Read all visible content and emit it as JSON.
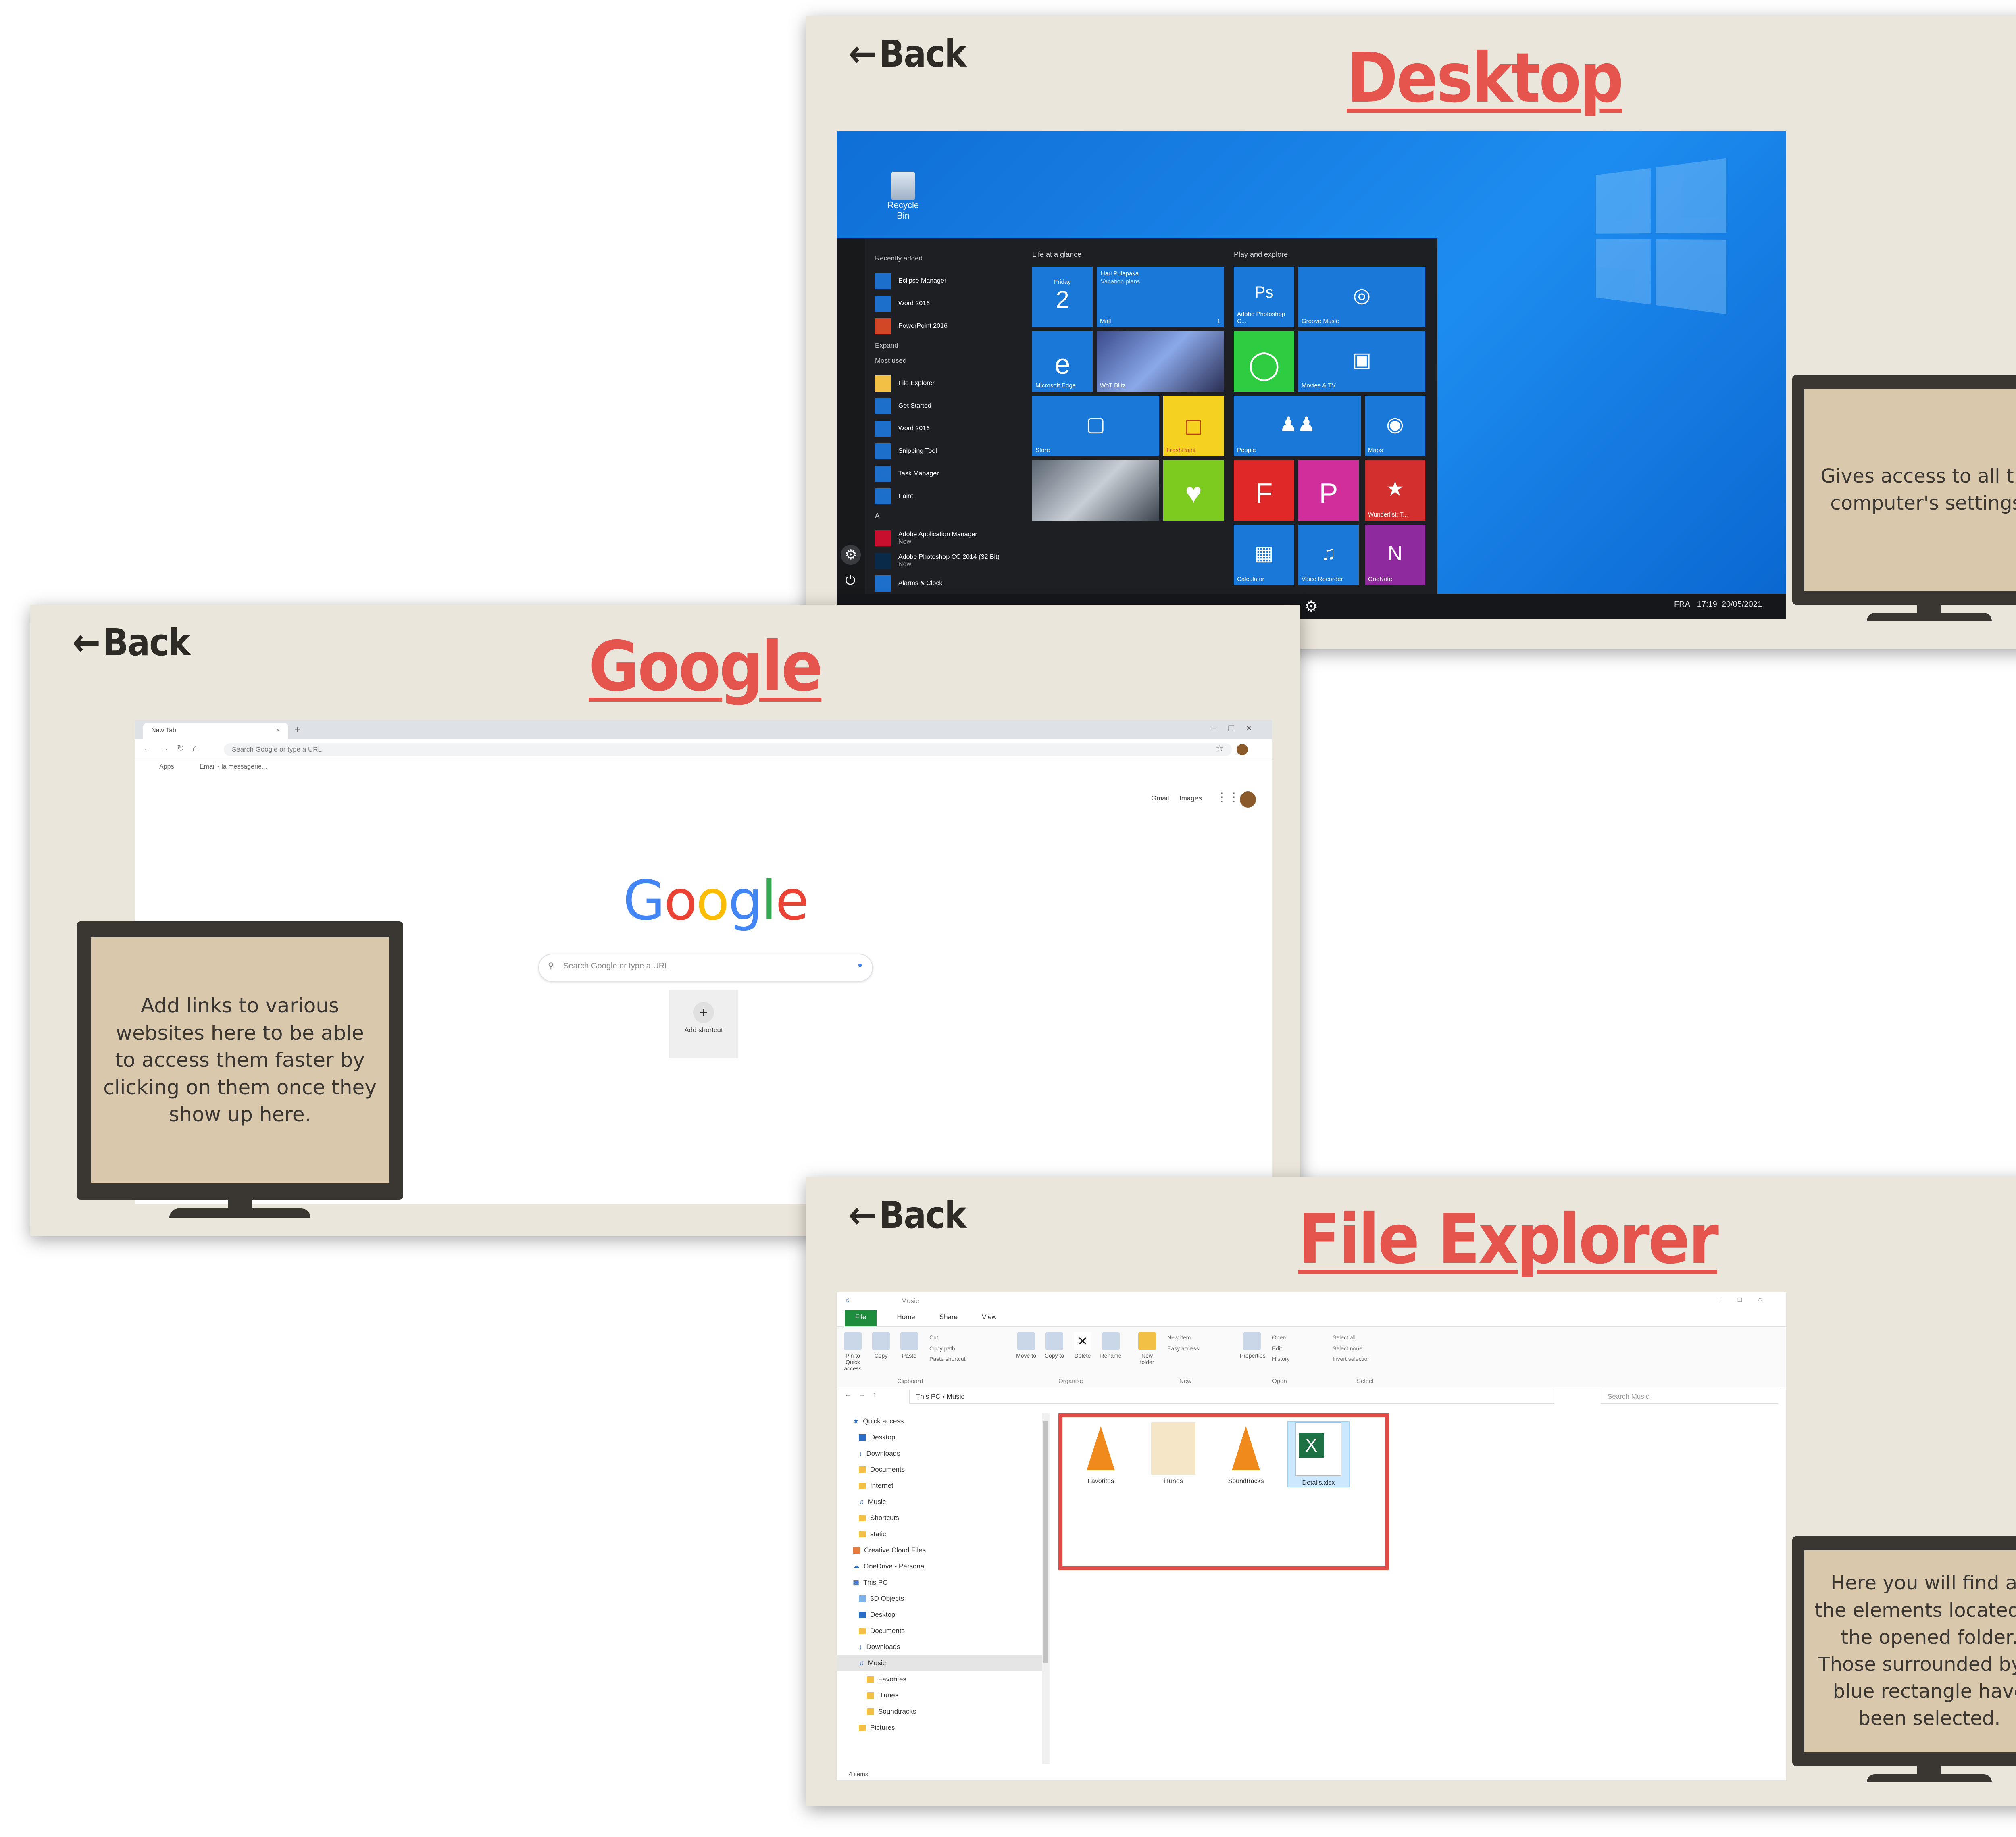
{
  "back_label": "Back",
  "desktop": {
    "title": "Desktop",
    "tooltip": "Gives access to all the computer's settings.",
    "recycle_bin": "Recycle Bin",
    "startmenu": {
      "recent_heading": "Recently added",
      "recent": [
        "Eclipse Manager",
        "Word 2016",
        "PowerPoint 2016"
      ],
      "expand": "Expand",
      "most_used_heading": "Most used",
      "most_used": [
        "File Explorer",
        "Get Started",
        "Word 2016",
        "Snipping Tool",
        "Task Manager",
        "Paint"
      ],
      "letter": "A",
      "a_apps": [
        "Adobe Application Manager",
        "Adobe Photoshop CC 2014 (32 Bit)",
        "Alarms & Clock"
      ],
      "new_label": "New",
      "group1": "Life at a glance",
      "group2": "Play and explore",
      "tiles": {
        "calendar_day": "Friday",
        "calendar_date": "2",
        "mail_from": "Hari Pulapaka",
        "mail_subject": "Vacation plans",
        "mail": "Mail",
        "mail_count": "1",
        "edge": "Microsoft Edge",
        "wot": "WoT Blitz",
        "store": "Store",
        "freshpaint": "FreshPaint",
        "photoshop": "Adobe Photoshop C...",
        "groove": "Groove Music",
        "movies": "Movies & TV",
        "people": "People",
        "maps": "Maps",
        "wunderlist": "Wunderlist: T...",
        "calculator": "Calculator",
        "voice": "Voice Recorder",
        "onenote": "OneNote"
      }
    },
    "taskbar": {
      "lang": "FRA",
      "time": "17:19",
      "date": "20/05/2021"
    }
  },
  "google": {
    "title": "Google",
    "tooltip": "Add links to various websites here to be able to access them faster by clicking on them once they show up here.",
    "tab_label": "New Tab",
    "address_placeholder": "Search Google or type a URL",
    "bookmarks": [
      "Apps",
      "Email - la messagerie..."
    ],
    "top_links": [
      "Gmail",
      "Images"
    ],
    "search_placeholder": "Search Google or type a URL",
    "shortcut_label": "Add shortcut",
    "logo_letters": [
      "G",
      "o",
      "o",
      "g",
      "l",
      "e"
    ]
  },
  "explorer": {
    "title": "File Explorer",
    "tooltip": "Here you will find all the elements located in the opened folder. Those surrounded by a blue rectangle have been selected.",
    "window_title": "Music",
    "tabs": [
      "File",
      "Home",
      "Share",
      "View"
    ],
    "ribbon_buttons": [
      "Pin to Quick access",
      "Copy",
      "Paste",
      "Move to",
      "Copy to",
      "Delete",
      "Rename",
      "New folder",
      "Properties"
    ],
    "ribbon_small": [
      "Cut",
      "Copy path",
      "Paste shortcut",
      "New item",
      "Easy access",
      "Open",
      "Edit",
      "History",
      "Select all",
      "Select none",
      "Invert selection"
    ],
    "groups": [
      "Clipboard",
      "Organise",
      "New",
      "Open",
      "Select"
    ],
    "path": [
      "This PC",
      "Music"
    ],
    "search_placeholder": "Search Music",
    "tree": [
      "Quick access",
      "Desktop",
      "Downloads",
      "Documents",
      "Internet",
      "Music",
      "Shortcuts",
      "static",
      "Creative Cloud Files",
      "OneDrive - Personal",
      "This PC",
      "3D Objects",
      "Desktop",
      "Documents",
      "Downloads",
      "Music",
      "Favorites",
      "iTunes",
      "Soundtracks",
      "Pictures"
    ],
    "files": [
      "Favorites",
      "iTunes",
      "Soundtracks",
      "Details.xlsx"
    ],
    "status": "4 items"
  },
  "colors": {
    "card_bg": "#ebe6db",
    "accent_title": "#e5554d",
    "monitor_frame": "#3a3632",
    "monitor_screen": "#dac8ad",
    "selection_box": "#e44a47"
  }
}
